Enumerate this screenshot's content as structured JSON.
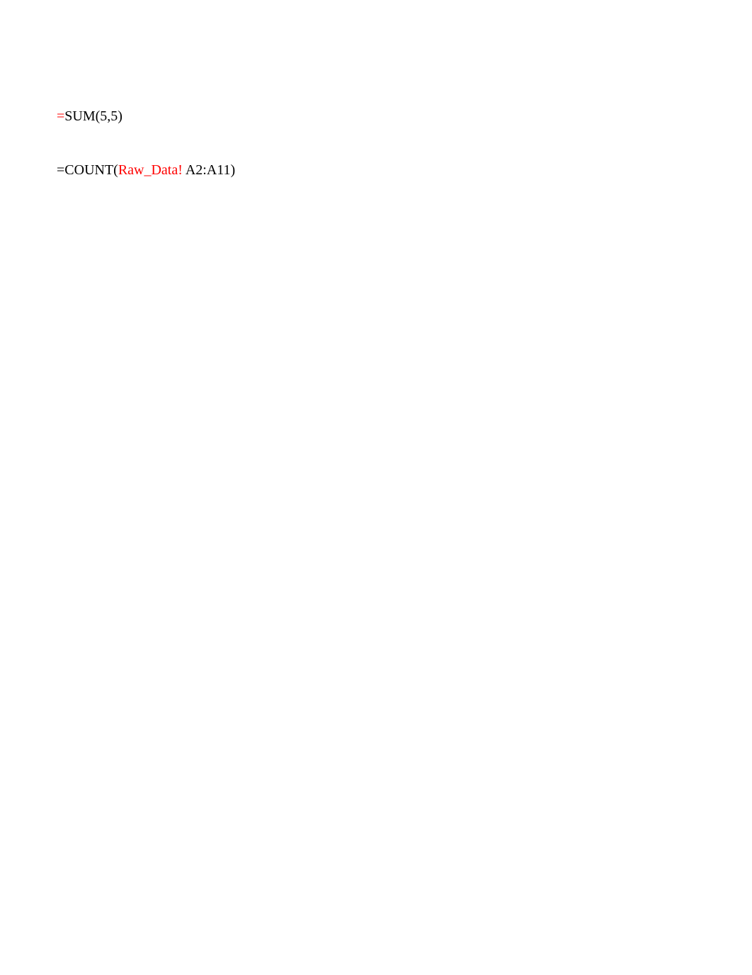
{
  "line1": {
    "equals": "=",
    "rest": "SUM(5,5)"
  },
  "line2": {
    "prefix": "=COUNT(",
    "sheet_ref": "Raw_Data!",
    "space": " ",
    "range": "A2:A11)"
  }
}
